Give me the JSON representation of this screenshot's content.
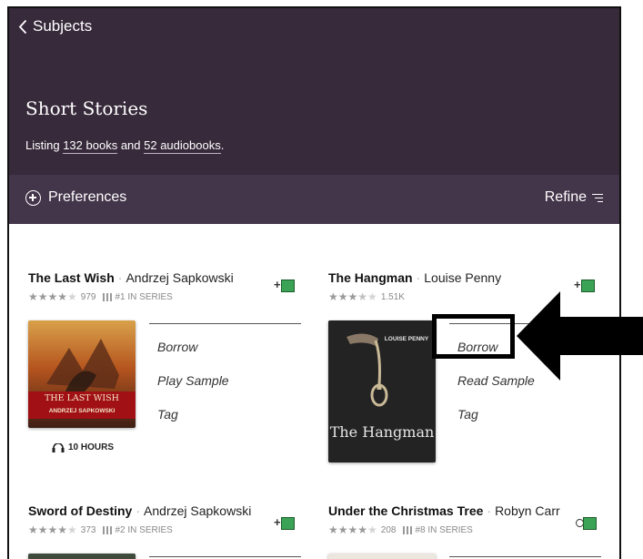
{
  "header": {
    "back_label": "Subjects",
    "title": "Short Stories",
    "listing_prefix": "Listing ",
    "books_link": "132 books",
    "listing_middle": " and ",
    "audiobooks_link": "52 audiobooks",
    "listing_suffix": "."
  },
  "toolbar": {
    "preferences_label": "Preferences",
    "refine_label": "Refine"
  },
  "books": [
    {
      "title": "The Last Wish",
      "author": "Andrzej Sapkowski",
      "rating_count": "979",
      "series": "#1 IN SERIES",
      "actions": [
        "Borrow",
        "Play Sample",
        "Tag"
      ],
      "duration": "10 HOURS",
      "cover_title": "THE LAST WISH",
      "cover_author": "ANDRZEJ SAPKOWSKI"
    },
    {
      "title": "The Hangman",
      "author": "Louise Penny",
      "rating_count": "1.51K",
      "actions": [
        "Borrow",
        "Read Sample",
        "Tag"
      ],
      "cover_author": "LOUISE PENNY",
      "cover_title": "The Hangman"
    },
    {
      "title": "Sword of Destiny",
      "author": "Andrzej Sapkowski",
      "rating_count": "373",
      "series": "#2 IN SERIES"
    },
    {
      "title": "Under the Christmas Tree",
      "author": "Robyn Carr",
      "rating_count": "208",
      "series": "#8 IN SERIES"
    }
  ],
  "colors": {
    "header_bg": "#372a3b",
    "prefbar_bg": "#43354a",
    "add_green": "#3aa355"
  }
}
